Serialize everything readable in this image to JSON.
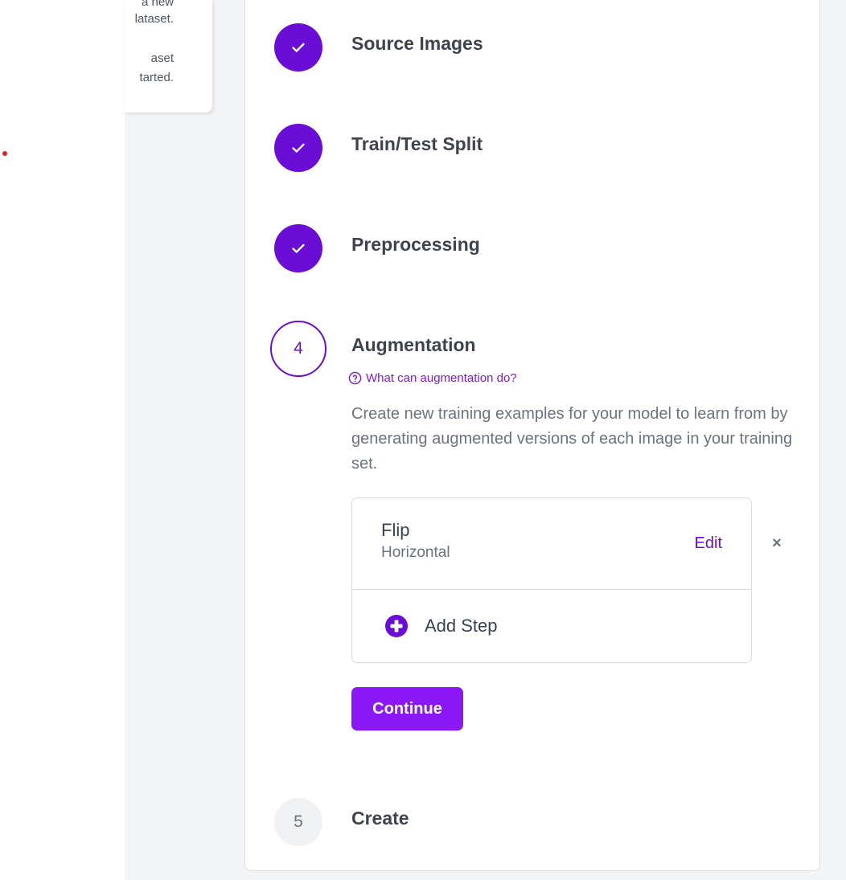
{
  "popover": {
    "lines": [
      "a new",
      "lataset.",
      "aset",
      "tarted."
    ]
  },
  "steps": [
    {
      "title": "Source Images",
      "status": "done",
      "icon": "check-icon"
    },
    {
      "title": "Train/Test Split",
      "status": "done",
      "icon": "check-icon"
    },
    {
      "title": "Preprocessing",
      "status": "done",
      "icon": "check-icon"
    },
    {
      "number": "4",
      "title": "Augmentation",
      "status": "current"
    },
    {
      "number": "5",
      "title": "Create",
      "status": "pending"
    }
  ],
  "augmentation": {
    "help_link": "What can augmentation do?",
    "description": "Create new training examples for your model to learn from by generating augmented versions of each image in your training set.",
    "items": [
      {
        "name": "Flip",
        "value": "Horizontal",
        "edit_label": "Edit",
        "remove_label": "×"
      }
    ],
    "add_step_label": "Add Step",
    "continue_label": "Continue"
  },
  "colors": {
    "accent": "#6a0dd6",
    "button": "#8b17f7",
    "page_bg": "#f3f4f6"
  }
}
